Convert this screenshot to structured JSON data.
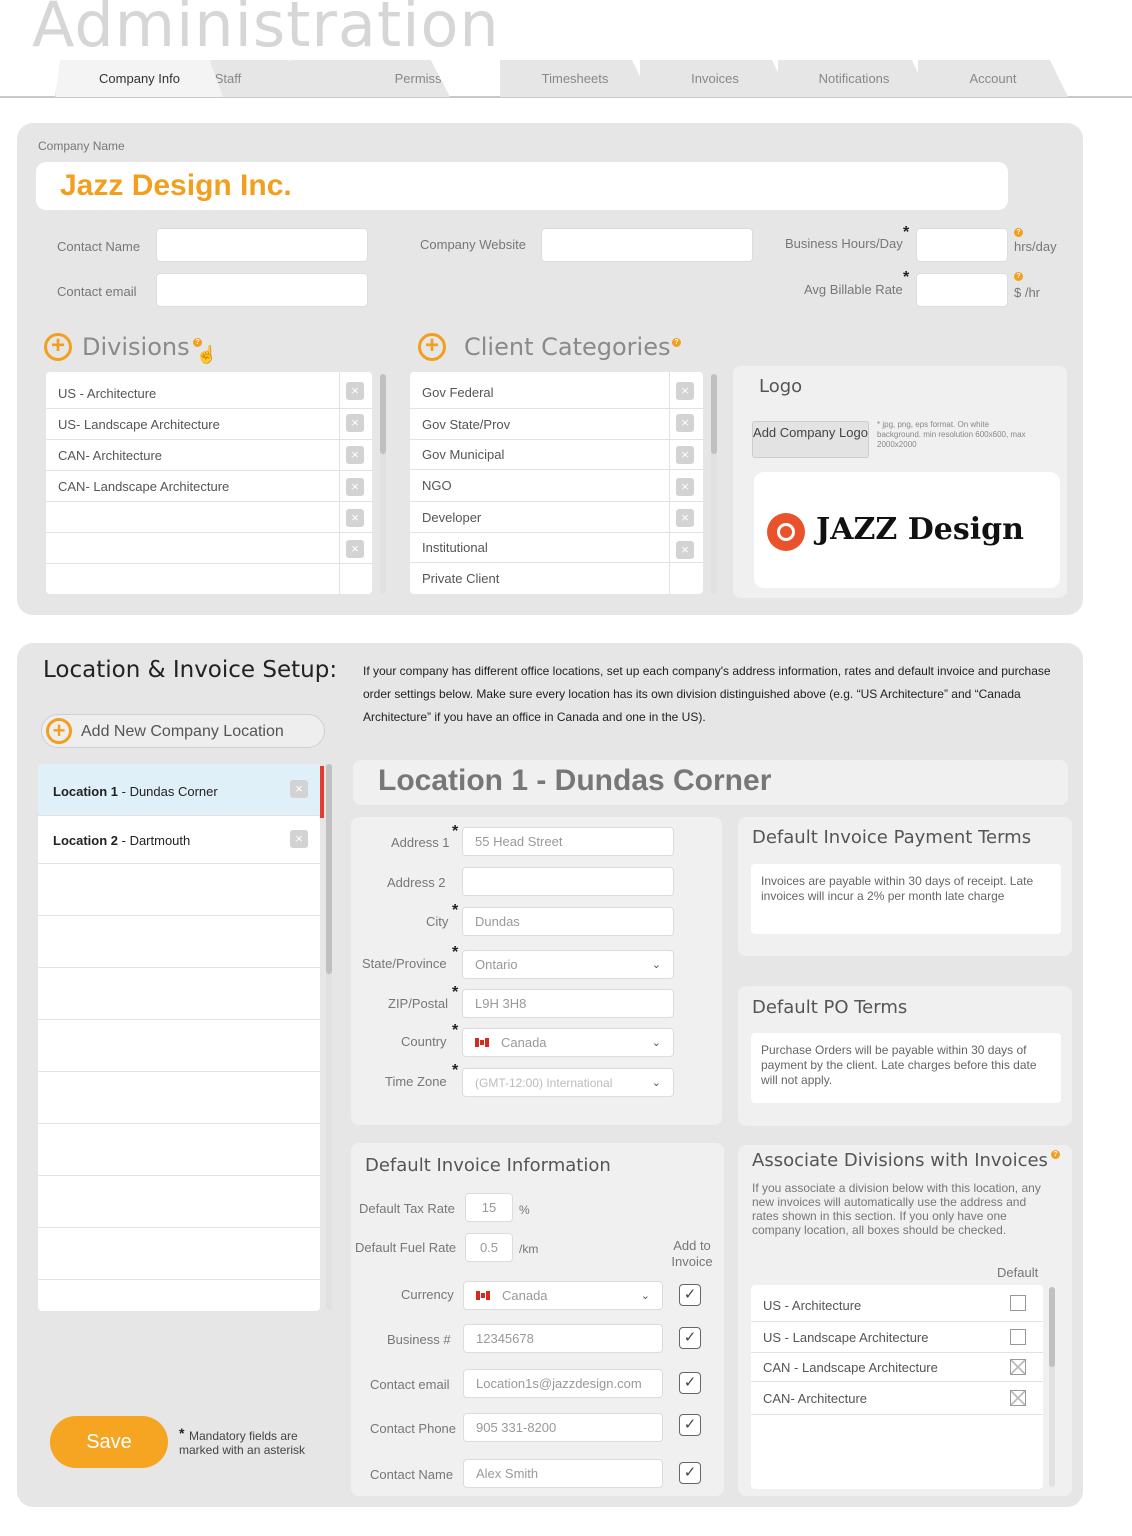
{
  "app": {
    "title": "Administration"
  },
  "tabs": [
    {
      "label": "Company Info",
      "active": true
    },
    {
      "label": "Staff"
    },
    {
      "label": "Permissions"
    },
    {
      "label": "Timesheets"
    },
    {
      "label": "Invoices"
    },
    {
      "label": "Notifications"
    },
    {
      "label": "Account"
    }
  ],
  "company": {
    "name_label": "Company Name",
    "name_value": "Jazz Design Inc.",
    "contact_name_label": "Contact Name",
    "contact_email_label": "Contact email",
    "website_label": "Company Website",
    "hours_label": "Business Hours/Day",
    "hours_unit": "hrs/day",
    "rate_label": "Avg Billable Rate",
    "rate_unit": "$ /hr"
  },
  "divisions": {
    "title": "Divisions",
    "items": [
      "US - Architecture",
      "US- Landscape Architecture",
      "CAN- Architecture",
      "CAN- Landscape Architecture",
      "",
      ""
    ]
  },
  "client_categories": {
    "title": "Client Categories",
    "items": [
      "Gov Federal",
      "Gov State/Prov",
      "Gov Municipal",
      "NGO",
      "Developer",
      "Institutional",
      "Private Client"
    ]
  },
  "logo": {
    "title": "Logo",
    "button": "Add Company Logo",
    "hint": "* jpg, png, eps format. On white background. min resolution 600x600, max 2000x2000",
    "brand_text": "JAZZ Design"
  },
  "location_setup": {
    "title": "Location & Invoice Setup:",
    "description": "If your company has different office locations, set up each company's address information, rates and default invoice and purchase order settings below. Make sure every location has its own division distinguished above (e.g. “US Architecture” and “Canada Architecture” if you have an office in Canada and one in the US).",
    "add_button": "Add New Company Location",
    "locations": [
      {
        "prefix": "Location 1",
        "name": " - Dundas Corner",
        "selected": true
      },
      {
        "prefix": "Location 2",
        "name": " - Dartmouth"
      }
    ],
    "heading": "Location 1 - Dundas Corner"
  },
  "address": {
    "address1_label": "Address 1",
    "address1_value": "55 Head Street",
    "address2_label": "Address 2",
    "address2_value": "",
    "city_label": "City",
    "city_value": "Dundas",
    "state_label": "State/Province",
    "state_value": "Ontario",
    "zip_label": "ZIP/Postal",
    "zip_value": "L9H 3H8",
    "country_label": "Country",
    "country_value": "Canada",
    "tz_label": "Time Zone",
    "tz_value": "(GMT-12:00) International"
  },
  "payment_terms": {
    "title": "Default Invoice Payment Terms",
    "text": "Invoices are payable within 30 days of receipt. Late invoices will incur a 2% per month late charge"
  },
  "po_terms": {
    "title": "Default PO Terms",
    "text": "Purchase Orders will be payable within 30 days of payment by the client. Late charges before this date will not apply."
  },
  "invoice_info": {
    "title": "Default Invoice Information",
    "tax_label": "Default Tax Rate",
    "tax_value": "15",
    "tax_unit": "%",
    "fuel_label": "Default Fuel Rate",
    "fuel_value": "0.5",
    "fuel_unit": "/km",
    "add_to_invoice": "Add to Invoice",
    "currency_label": "Currency",
    "currency_value": "Canada",
    "business_label": "Business #",
    "business_value": "12345678",
    "email_label": "Contact email",
    "email_value": "Location1s@jazzdesign.com",
    "phone_label": "Contact Phone",
    "phone_value": "905 331-8200",
    "name_label": "Contact Name",
    "name_value": "Alex Smith"
  },
  "associate": {
    "title": "Associate Divisions with Invoices",
    "text": "If you associate a division below with this location, any new invoices will automatically use the address and rates shown in this section. If you only have one company location, all boxes should be checked.",
    "default_label": "Default",
    "items": [
      {
        "label": "US - Architecture",
        "checked": false
      },
      {
        "label": "US - Landscape Architecture",
        "checked": false
      },
      {
        "label": "CAN - Landscape Architecture",
        "checked": true
      },
      {
        "label": "CAN- Architecture",
        "checked": true
      }
    ]
  },
  "footer": {
    "save": "Save",
    "note": "Mandatory fields are marked with an asterisk"
  },
  "colors": {
    "accent": "#f29f1f",
    "panel": "#e6e6e6",
    "selected": "#dff0f8"
  }
}
